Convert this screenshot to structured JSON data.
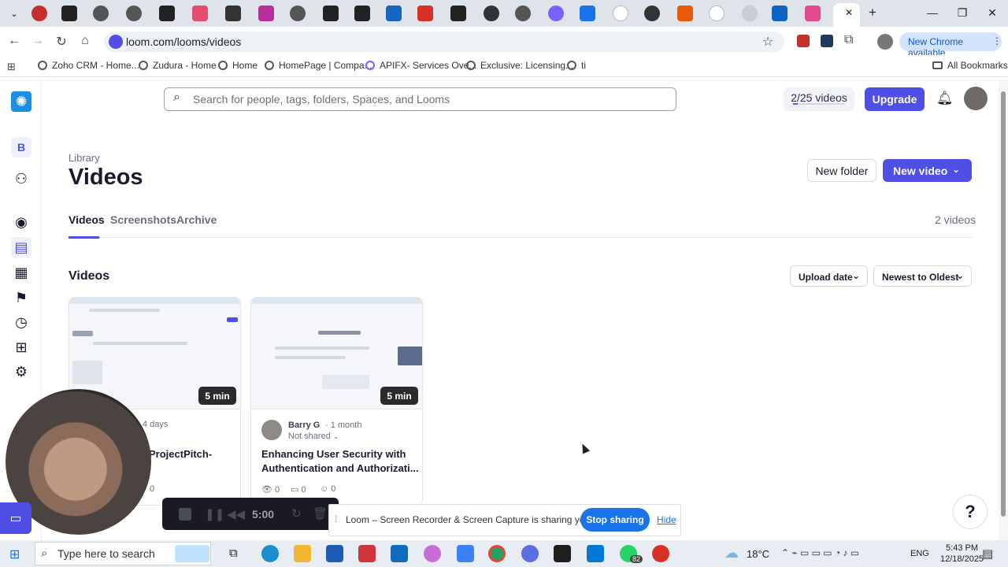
{
  "browser": {
    "url": "loom.com/looms/videos",
    "new_chrome_label": "New Chrome available",
    "all_bookmarks_label": "All Bookmarks",
    "bookmarks": [
      "Zoho CRM - Home...",
      "Zudura - Home",
      "Home",
      "HomePage | Compa...",
      "APIFX- Services Ove...",
      "Exclusive: Licensing...",
      "ti"
    ]
  },
  "loom": {
    "search_placeholder": "Search for people, tags, folders, Spaces, and Looms",
    "video_count_label": "2/25 videos",
    "video_usage_fraction": 0.08,
    "upgrade_label": "Upgrade",
    "workspace_initial": "B",
    "breadcrumb": "Library",
    "page_title": "Videos",
    "new_folder_label": "New folder",
    "new_video_label": "New video",
    "tabs": [
      "Videos",
      "Screenshots",
      "Archive"
    ],
    "count_label": "2 videos",
    "section_title": "Videos",
    "sort_field_label": "Upload date",
    "sort_order_label": "Newest to Oldest",
    "videos": [
      {
        "duration": "5 min",
        "age": "4 days",
        "title": "ProjectPitch-",
        "comments": "0"
      },
      {
        "duration": "5 min",
        "author": "Barry G",
        "age": "· 1 month",
        "sharing": "Not shared",
        "title_line1": "Enhancing User Security with",
        "title_line2": "Authentication and Authorizati...",
        "views": "0",
        "comments": "0",
        "reactions": "0"
      }
    ]
  },
  "recorder": {
    "timer": "5:00",
    "share_notice": "Loom – Screen Recorder & Screen Capture is sharing your screen.",
    "stop_sharing_label": "Stop sharing",
    "hide_label": "Hide"
  },
  "help_label": "?",
  "taskbar": {
    "search_placeholder": "Type here to search",
    "weather": "18°C",
    "language": "ENG",
    "time": "5:43 PM",
    "date": "12/18/2025",
    "badge": "82"
  },
  "colors": {
    "accent": "#4f4ee5",
    "chrome_blue": "#1a73e8"
  }
}
